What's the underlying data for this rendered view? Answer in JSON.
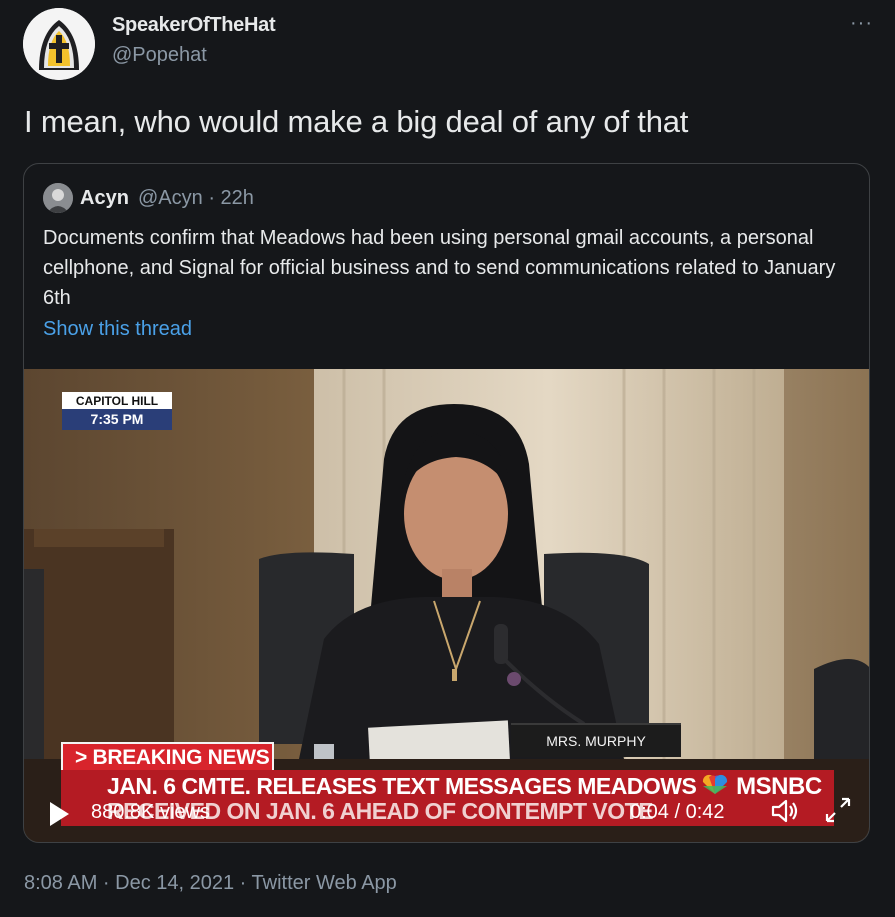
{
  "tweet": {
    "display_name": "SpeakerOfTheHat",
    "handle": "@Popehat",
    "text": "I mean, who would make a big deal of any of that",
    "more_label": "···",
    "timestamp": "8:08 AM · Dec 14, 2021 · Twitter Web App"
  },
  "quote": {
    "display_name": "Acyn",
    "meta": "@Acyn · 22h",
    "text": "Documents confirm that Meadows had been using personal gmail accounts, a personal cellphone, and Signal for official business and to send communications related to January 6th",
    "thread_link": "Show this thread"
  },
  "video": {
    "location_label": "CAPITOL HILL",
    "time_label": "7:35 PM",
    "nameplate": "MRS. MURPHY",
    "breaking_label": "> BREAKING NEWS",
    "headline_line1": "JAN. 6 CMTE. RELEASES TEXT MESSAGES MEADOWS",
    "headline_line2": "RECEIVED ON JAN. 6 AHEAD OF CONTEMPT VOTE",
    "network": "MSNBC",
    "views": "880.8K views",
    "time_current": "0:04",
    "time_total": "0:42",
    "time_display": "0:04 / 0:42",
    "progress": 0.095
  },
  "colors": {
    "background": "#15171a",
    "link": "#4aa1e8",
    "muted": "#8b98a5",
    "breaking_red": "#d8242c"
  }
}
